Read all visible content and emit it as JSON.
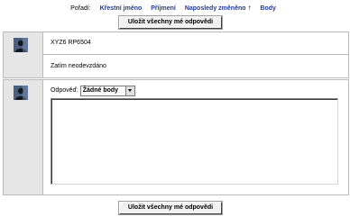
{
  "sort": {
    "label": "Pořadí:",
    "options": [
      {
        "label": "Křestní jméno"
      },
      {
        "label": "Příjmení"
      },
      {
        "label": "Naposledy změněno"
      },
      {
        "label": "Body"
      }
    ],
    "active_arrow": "↑"
  },
  "save_button_label": "Uložit všechny mé odpovědi",
  "submission": {
    "name": "XYZ6 RP6504",
    "status": "Zatím neodevzdáno"
  },
  "feedback": {
    "label": "Odpověď:",
    "grade_select_value": "Žádné body",
    "comment_value": ""
  },
  "icons": {
    "avatar": "user-avatar-icon",
    "dropdown": "chevron-down-icon"
  }
}
